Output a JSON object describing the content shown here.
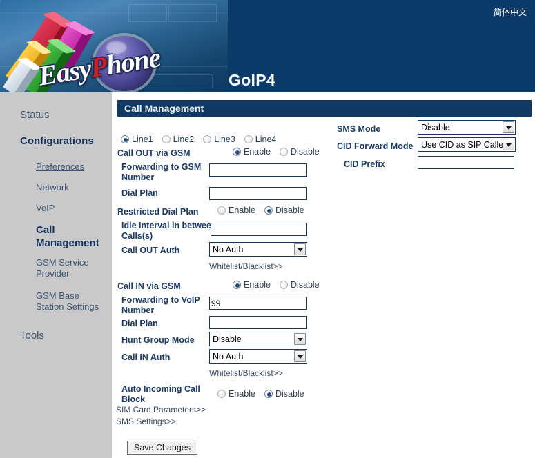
{
  "banner": {
    "logo_text_a": "Easy",
    "logo_text_b": "P",
    "logo_text_c": "hone",
    "product_title": "GoIP4",
    "language_link": "简体中文"
  },
  "sidebar": {
    "items": [
      {
        "label": "Status",
        "level": "top",
        "state": "normal"
      },
      {
        "label": "Configurations",
        "level": "top",
        "state": "bold"
      },
      {
        "label": "Preferences",
        "level": "sub",
        "state": "hover"
      },
      {
        "label": "Network",
        "level": "sub",
        "state": "normal"
      },
      {
        "label": "VoIP",
        "level": "sub",
        "state": "normal"
      },
      {
        "label": "Call Management",
        "level": "sub",
        "state": "active"
      },
      {
        "label": "GSM Service Provider",
        "level": "sub",
        "state": "normal"
      },
      {
        "label": "GSM Base Station Settings",
        "level": "sub",
        "state": "normal"
      },
      {
        "label": "Tools",
        "level": "top",
        "state": "normal"
      }
    ]
  },
  "panel": {
    "title": "Call Management",
    "lines": {
      "options": [
        "Line1",
        "Line2",
        "Line3",
        "Line4"
      ],
      "selected": "Line1"
    },
    "left_column": {
      "call_out_via_gsm": {
        "label": "Call OUT via GSM",
        "options": [
          "Enable",
          "Disable"
        ],
        "selected": "Enable"
      },
      "forwarding_to_gsm_number": {
        "label": "Forwarding to GSM Number",
        "value": ""
      },
      "dial_plan_out": {
        "label": "Dial Plan",
        "value": ""
      },
      "restricted_dial_plan": {
        "label": "Restricted Dial Plan",
        "options": [
          "Enable",
          "Disable"
        ],
        "selected": "Disable"
      },
      "idle_interval": {
        "label": "Idle Interval in between Calls(s)",
        "value": ""
      },
      "call_out_auth": {
        "label": "Call OUT Auth",
        "value": "No Auth",
        "options": [
          "No Auth"
        ]
      },
      "whitelist_out_link": "Whitelist/Blacklist>>",
      "call_in_via_gsm": {
        "label": "Call IN via GSM",
        "options": [
          "Enable",
          "Disable"
        ],
        "selected": "Enable"
      },
      "forwarding_to_voip_number": {
        "label": "Forwarding to VoIP Number",
        "value": "99"
      },
      "dial_plan_in": {
        "label": "Dial Plan",
        "value": ""
      },
      "hunt_group_mode": {
        "label": "Hunt Group Mode",
        "value": "Disable",
        "options": [
          "Disable"
        ]
      },
      "call_in_auth": {
        "label": "Call IN Auth",
        "value": "No Auth",
        "options": [
          "No Auth"
        ]
      },
      "whitelist_in_link": "Whitelist/Blacklist>>",
      "auto_incoming_call_block": {
        "label": "Auto Incoming Call Block",
        "options": [
          "Enable",
          "Disable"
        ],
        "selected": "Disable"
      },
      "sim_card_parameters_link": "SIM Card Parameters>>",
      "sms_settings_link": "SMS Settings>>"
    },
    "right_column": {
      "sms_mode": {
        "label": "SMS Mode",
        "value": "Disable",
        "options": [
          "Disable"
        ]
      },
      "cid_forward_mode": {
        "label": "CID Forward Mode",
        "value": "Use CID as SIP Caller ID",
        "options": [
          "Use CID as SIP Caller ID"
        ]
      },
      "cid_prefix": {
        "label": "CID Prefix",
        "value": ""
      }
    },
    "save_button": "Save Changes"
  },
  "colors": {
    "banner_blue": "#0b3c69",
    "panel_header_blue": "#103a63",
    "sidebar_gray": "#c9c9c9",
    "label_blue": "#1b3a66",
    "field_border": "#17375e"
  }
}
